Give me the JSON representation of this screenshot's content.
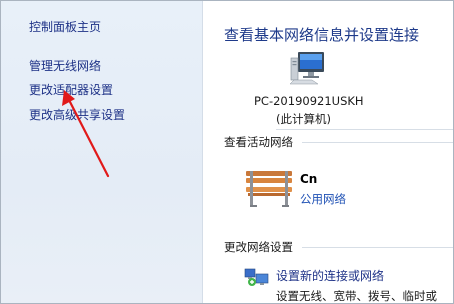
{
  "sidebar": {
    "items": [
      {
        "label": "控制面板主页"
      },
      {
        "label": "管理无线网络"
      },
      {
        "label": "更改适配器设置"
      },
      {
        "label": "更改高级共享设置"
      }
    ]
  },
  "main": {
    "title": "查看基本网络信息并设置连接",
    "computer": {
      "name": "PC-20190921USKH",
      "subtitle": "(此计算机)",
      "icon": "computer-icon"
    },
    "active_networks": {
      "label": "查看活动网络",
      "network_name": "Cn",
      "network_type": "公用网络",
      "icon": "bench-icon"
    },
    "change_settings": {
      "label": "更改网络设置",
      "setup_link": "设置新的连接或网络",
      "setup_desc": "设置无线、宽带、拨号、临时或",
      "icon": "network-setup-icon"
    }
  },
  "colors": {
    "link": "#1e3287",
    "title": "#1e3a8a",
    "annotation_arrow": "#e11a1a",
    "sidebar_bg": "#e6eef8"
  }
}
